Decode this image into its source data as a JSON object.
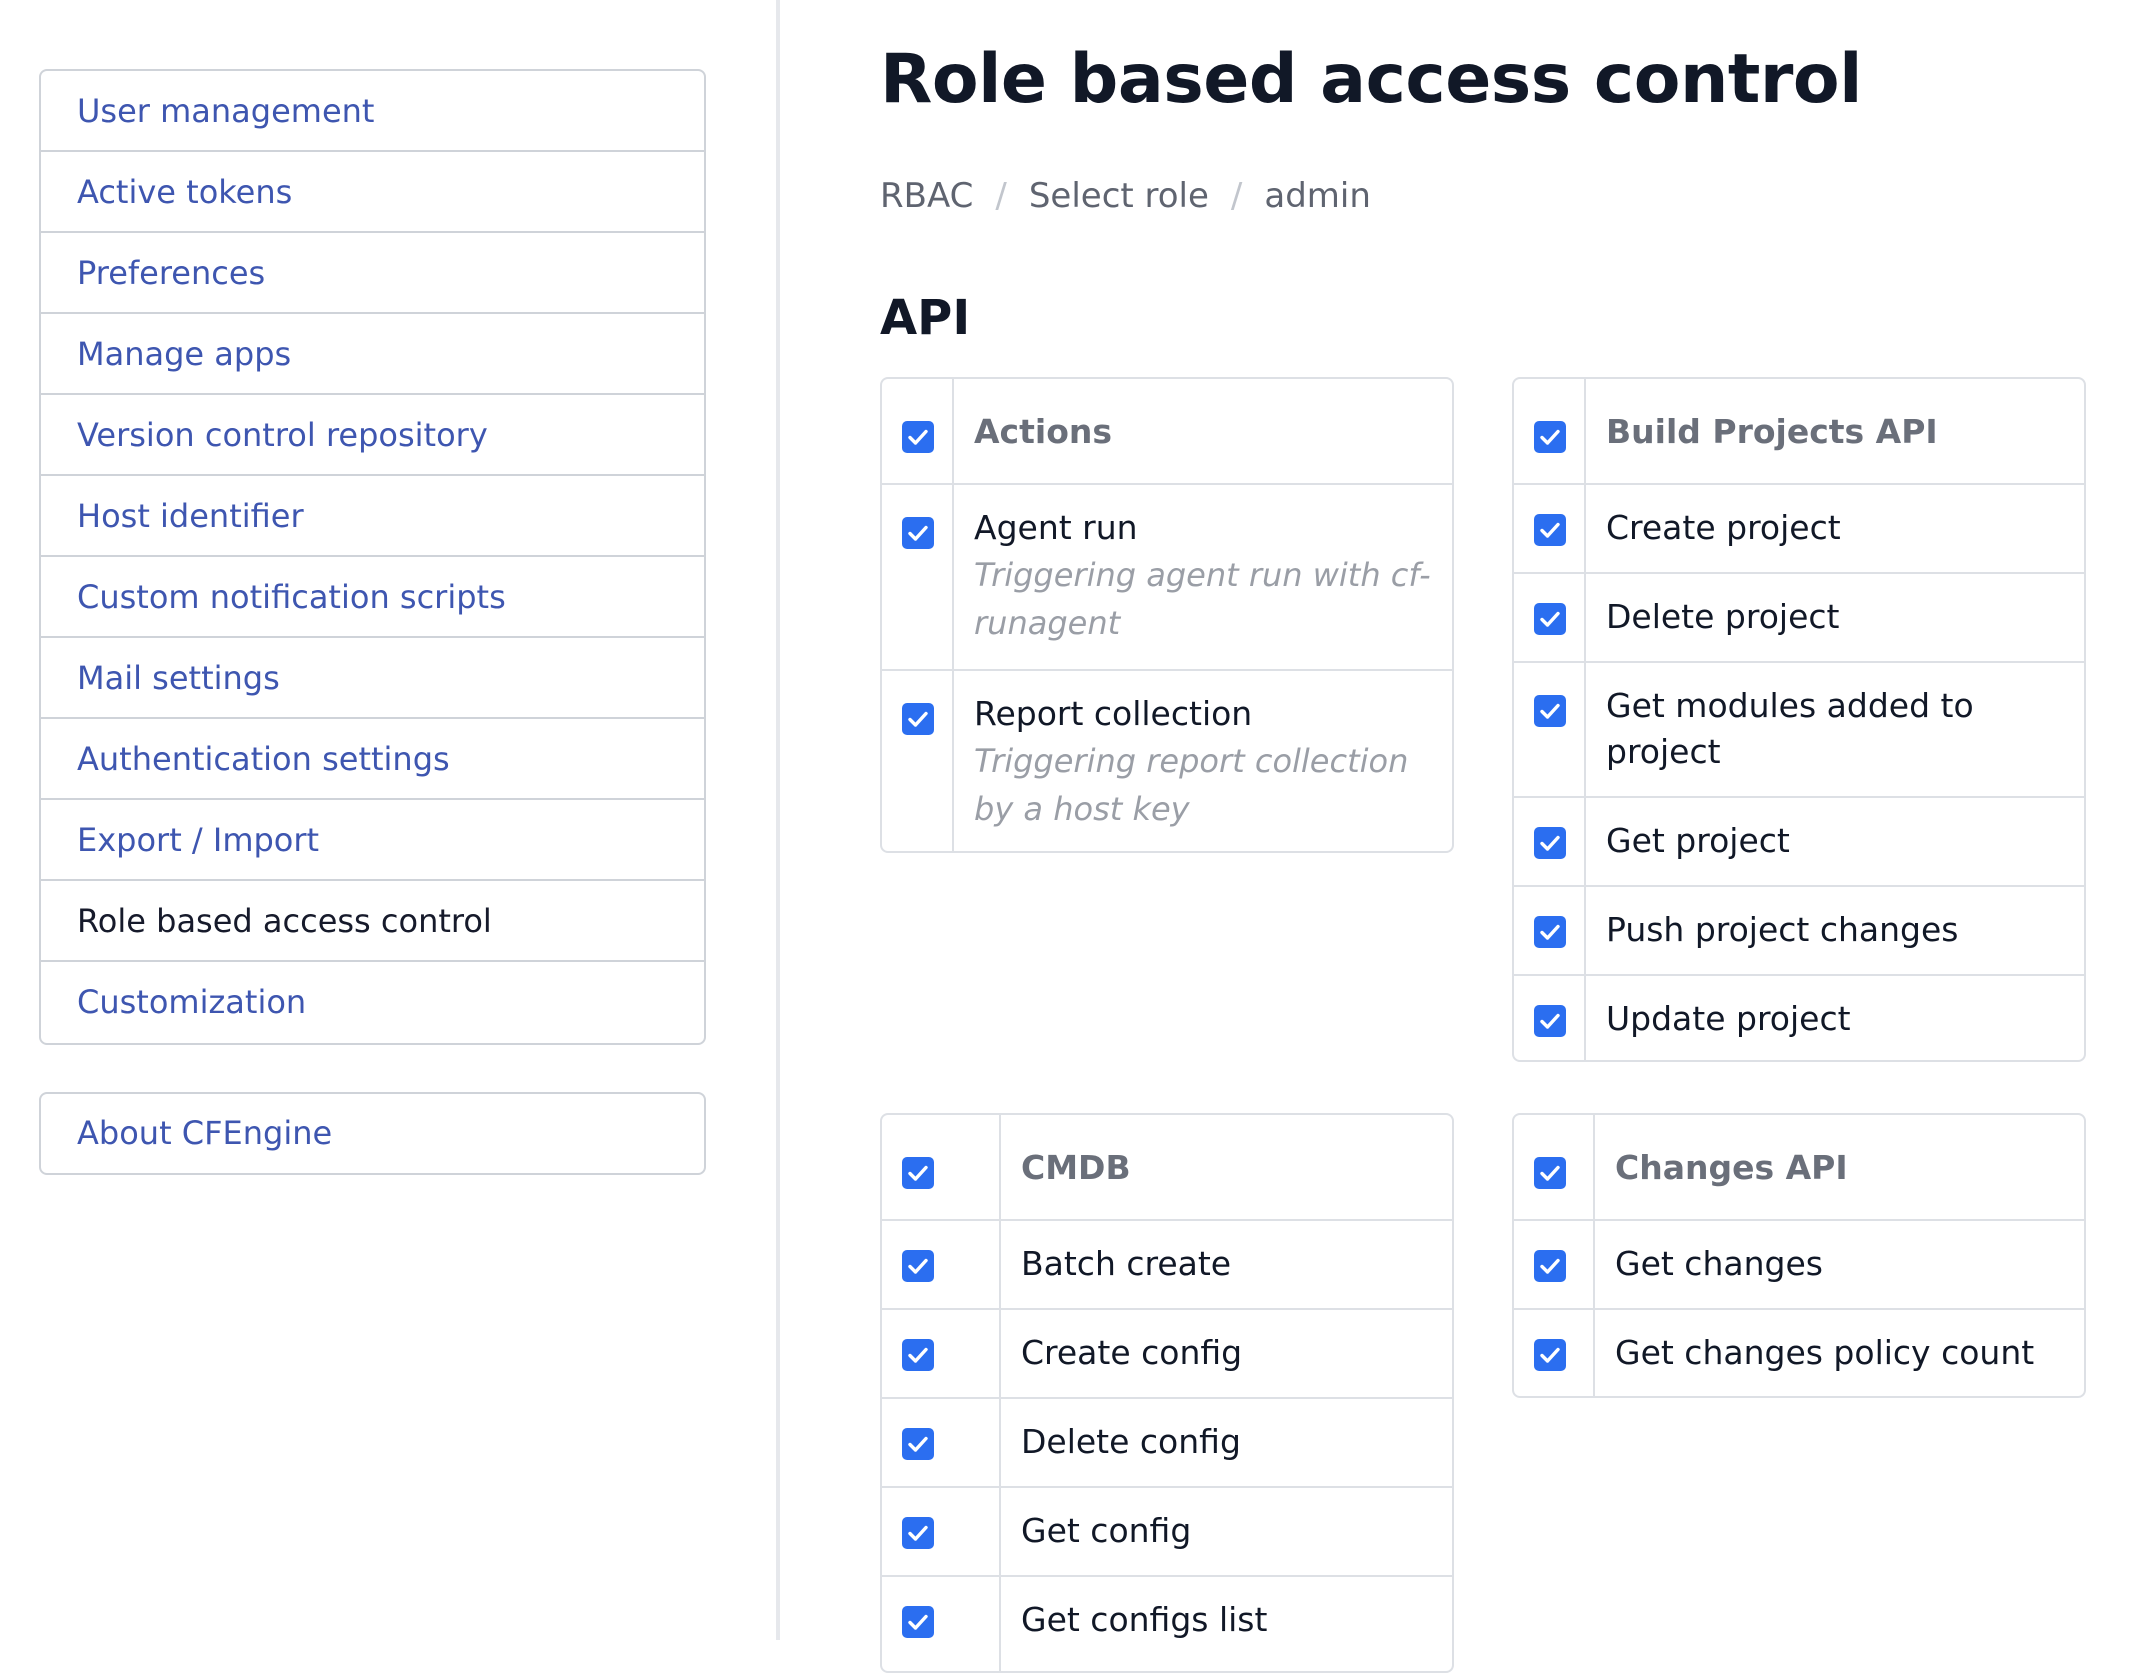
{
  "sidebar": {
    "items": [
      {
        "label": "User management"
      },
      {
        "label": "Active tokens"
      },
      {
        "label": "Preferences"
      },
      {
        "label": "Manage apps"
      },
      {
        "label": "Version control repository"
      },
      {
        "label": "Host identifier"
      },
      {
        "label": "Custom notification scripts"
      },
      {
        "label": "Mail settings"
      },
      {
        "label": "Authentication settings"
      },
      {
        "label": "Export / Import"
      },
      {
        "label": "Role based access control",
        "active": true
      },
      {
        "label": "Customization"
      }
    ],
    "about": {
      "label": "About CFEngine"
    }
  },
  "page": {
    "title": "Role based access control",
    "breadcrumb": [
      "RBAC",
      "Select role",
      "admin"
    ],
    "breadcrumb_separator": "/",
    "section_title": "API"
  },
  "colors": {
    "link": "#3e56b0",
    "checkbox": "#2b6ef0",
    "heading": "#111827"
  },
  "tables": {
    "actions": {
      "header": "Actions",
      "rows": [
        {
          "label": "Agent run",
          "desc": "Triggering agent run with cf-runagent",
          "checked": true
        },
        {
          "label": "Report collection",
          "desc": "Triggering report collection by a host key",
          "checked": true
        }
      ]
    },
    "build_projects": {
      "header": "Build Projects API",
      "rows": [
        {
          "label": "Create project",
          "checked": true
        },
        {
          "label": "Delete project",
          "checked": true
        },
        {
          "label": "Get modules added to project",
          "checked": true
        },
        {
          "label": "Get project",
          "checked": true
        },
        {
          "label": "Push project changes",
          "checked": true
        },
        {
          "label": "Update project",
          "checked": true
        }
      ]
    },
    "cmdb": {
      "header": "CMDB",
      "rows": [
        {
          "label": "Batch create",
          "checked": true
        },
        {
          "label": "Create config",
          "checked": true
        },
        {
          "label": "Delete config",
          "checked": true
        },
        {
          "label": "Get config",
          "checked": true
        },
        {
          "label": "Get configs list",
          "checked": true
        }
      ]
    },
    "changes": {
      "header": "Changes API",
      "rows": [
        {
          "label": "Get changes",
          "checked": true
        },
        {
          "label": "Get changes policy count",
          "checked": true
        }
      ]
    }
  }
}
